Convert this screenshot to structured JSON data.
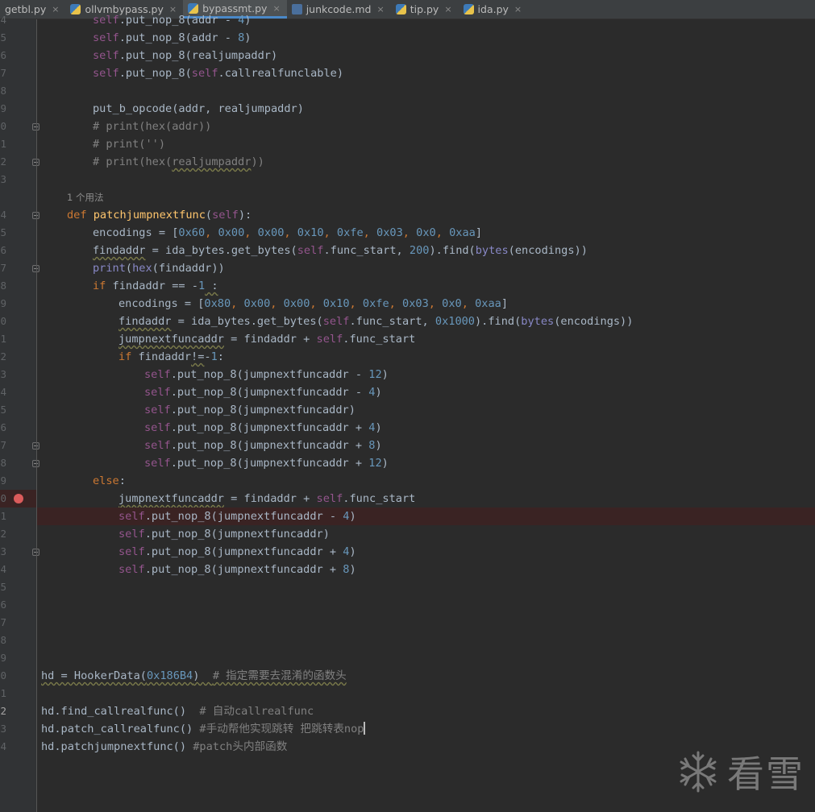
{
  "tabs": [
    {
      "name": "getbl.py",
      "icon": "python-file-icon",
      "active": false
    },
    {
      "name": "ollvmbypass.py",
      "icon": "python-file-icon",
      "active": false
    },
    {
      "name": "bypassmt.py",
      "icon": "python-file-icon",
      "active": true
    },
    {
      "name": "junkcode.md",
      "icon": "markdown-file-icon",
      "active": false
    },
    {
      "name": "tip.py",
      "icon": "python-file-icon",
      "active": false
    },
    {
      "name": "ida.py",
      "icon": "python-file-icon",
      "active": false
    }
  ],
  "tab_close_glyph": "×",
  "gutter": {
    "line_numbers": [
      "4",
      "5",
      "6",
      "7",
      "8",
      "9",
      "0",
      "1",
      "2",
      "3",
      "",
      "4",
      "5",
      "6",
      "7",
      "8",
      "9",
      "0",
      "1",
      "2",
      "3",
      "4",
      "5",
      "6",
      "7",
      "8",
      "9",
      "0",
      "1",
      "2",
      "3",
      "4",
      "5",
      "6",
      "7",
      "8",
      "9",
      "0",
      "1",
      "2",
      "3",
      "4"
    ]
  },
  "code": {
    "l0": "self.put_nop_8(addr - 4)",
    "l1_a": "self",
    "l1_b": ".put_nop_8(addr - ",
    "l1_c": "8",
    "l1_d": ")",
    "l2_a": "self",
    "l2_b": ".put_nop_8(realjumpaddr)",
    "l3_a": "self",
    "l3_b": ".put_nop_8(",
    "l3_c": "self",
    "l3_d": ".callrealfunclable)",
    "l5": "put_b_opcode(addr, realjumpaddr)",
    "l6": "# print(hex(addr))",
    "l7": "# print('')",
    "l8_a": "# print(hex(",
    "l8_b": "realjumpaddr",
    "l8_c": "))",
    "usage_hint": "1 个用法",
    "l10_kw": "def",
    "l10_fn": "patchjumpnextfunc",
    "l10_a": "(",
    "l10_self": "self",
    "l10_b": "):",
    "l11_a": "encodings = [",
    "l11_nums": [
      "0x60",
      "0x00",
      "0x00",
      "0x10",
      "0xfe",
      "0x03",
      "0x0",
      "0xaa"
    ],
    "l11_b": "]",
    "l12_var": "findaddr",
    "l12_a": " = ida_bytes.get_bytes(",
    "l12_self": "self",
    "l12_b": ".func_start, ",
    "l12_num": "200",
    "l12_c": ").find(",
    "l12_bi": "bytes",
    "l12_d": "(encodings))",
    "l13_bi1": "print",
    "l13_a": "(",
    "l13_bi2": "hex",
    "l13_b": "(findaddr))",
    "l14_kw": "if",
    "l14_a": " findaddr == -",
    "l14_num": "1",
    "l14_b": " :",
    "l15_a": "encodings = [",
    "l15_nums": [
      "0x80",
      "0x00",
      "0x00",
      "0x10",
      "0xfe",
      "0x03",
      "0x0",
      "0xaa"
    ],
    "l15_b": "]",
    "l16_var": "findaddr",
    "l16_a": " = ida_bytes.get_bytes(",
    "l16_self": "self",
    "l16_b": ".func_start, ",
    "l16_num": "0x1000",
    "l16_c": ").find(",
    "l16_bi": "bytes",
    "l16_d": "(encodings))",
    "l17_var": "jumpnextfuncaddr",
    "l17_a": " = findaddr + ",
    "l17_self": "self",
    "l17_b": ".func_start",
    "l18_kw": "if",
    "l18_a": " findaddr",
    "l18_op": "!=",
    "l18_b": "-",
    "l18_num": "1",
    "l18_c": ":",
    "l19_self": "self",
    "l19_a": ".put_nop_8(jumpnextfuncaddr - ",
    "l19_num": "12",
    "l19_b": ")",
    "l20_self": "self",
    "l20_a": ".put_nop_8(jumpnextfuncaddr - ",
    "l20_num": "4",
    "l20_b": ")",
    "l21_self": "self",
    "l21_a": ".put_nop_8(jumpnextfuncaddr)",
    "l22_self": "self",
    "l22_a": ".put_nop_8(jumpnextfuncaddr + ",
    "l22_num": "4",
    "l22_b": ")",
    "l23_self": "self",
    "l23_a": ".put_nop_8(jumpnextfuncaddr + ",
    "l23_num": "8",
    "l23_b": ")",
    "l24_self": "self",
    "l24_a": ".put_nop_8(jumpnextfuncaddr + ",
    "l24_num": "12",
    "l24_b": ")",
    "l25_kw": "else",
    "l25_a": ":",
    "l26_var": "jumpnextfuncaddr",
    "l26_a": " = findaddr + ",
    "l26_self": "self",
    "l26_b": ".func_start",
    "l27_self": "self",
    "l27_a": ".put_nop_8(jumpnextfuncaddr - ",
    "l27_num": "4",
    "l27_b": ")",
    "l28_self": "self",
    "l28_a": ".put_nop_8(jumpnextfuncaddr)",
    "l29_self": "self",
    "l29_a": ".put_nop_8(jumpnextfuncaddr + ",
    "l29_num": "4",
    "l29_b": ")",
    "l30_self": "self",
    "l30_a": ".put_nop_8(jumpnextfuncaddr + ",
    "l30_num": "8",
    "l30_b": ")",
    "l36_a": "hd = HookerData(",
    "l36_num": "0x186B4",
    "l36_b": ")  ",
    "l36_cm": "# 指定需要去混淆的函数头",
    "l38_a": "hd.find_callrealfunc()  ",
    "l38_cm": "# 自动callrealfunc",
    "l39_a": "hd.patch_callrealfunc()",
    "l39_cm": " #手动帮他实现跳转 把跳转表nop",
    "l40_a": "hd.patchjumpnextfunc()",
    "l40_cm": " #patch头内部函数"
  },
  "watermark": {
    "text": "看雪",
    "icon": "snowflake-logo-icon"
  },
  "colors": {
    "background": "#2b2b2b",
    "gutter": "#313335",
    "keyword": "#cc7832",
    "self": "#94558d",
    "number": "#6897bb",
    "function": "#ffc66d",
    "builtin": "#8888c6",
    "comment": "#808080",
    "text": "#a9b7c6",
    "breakpoint": "#db5c5c",
    "active_tab_underline": "#4a88c7"
  }
}
